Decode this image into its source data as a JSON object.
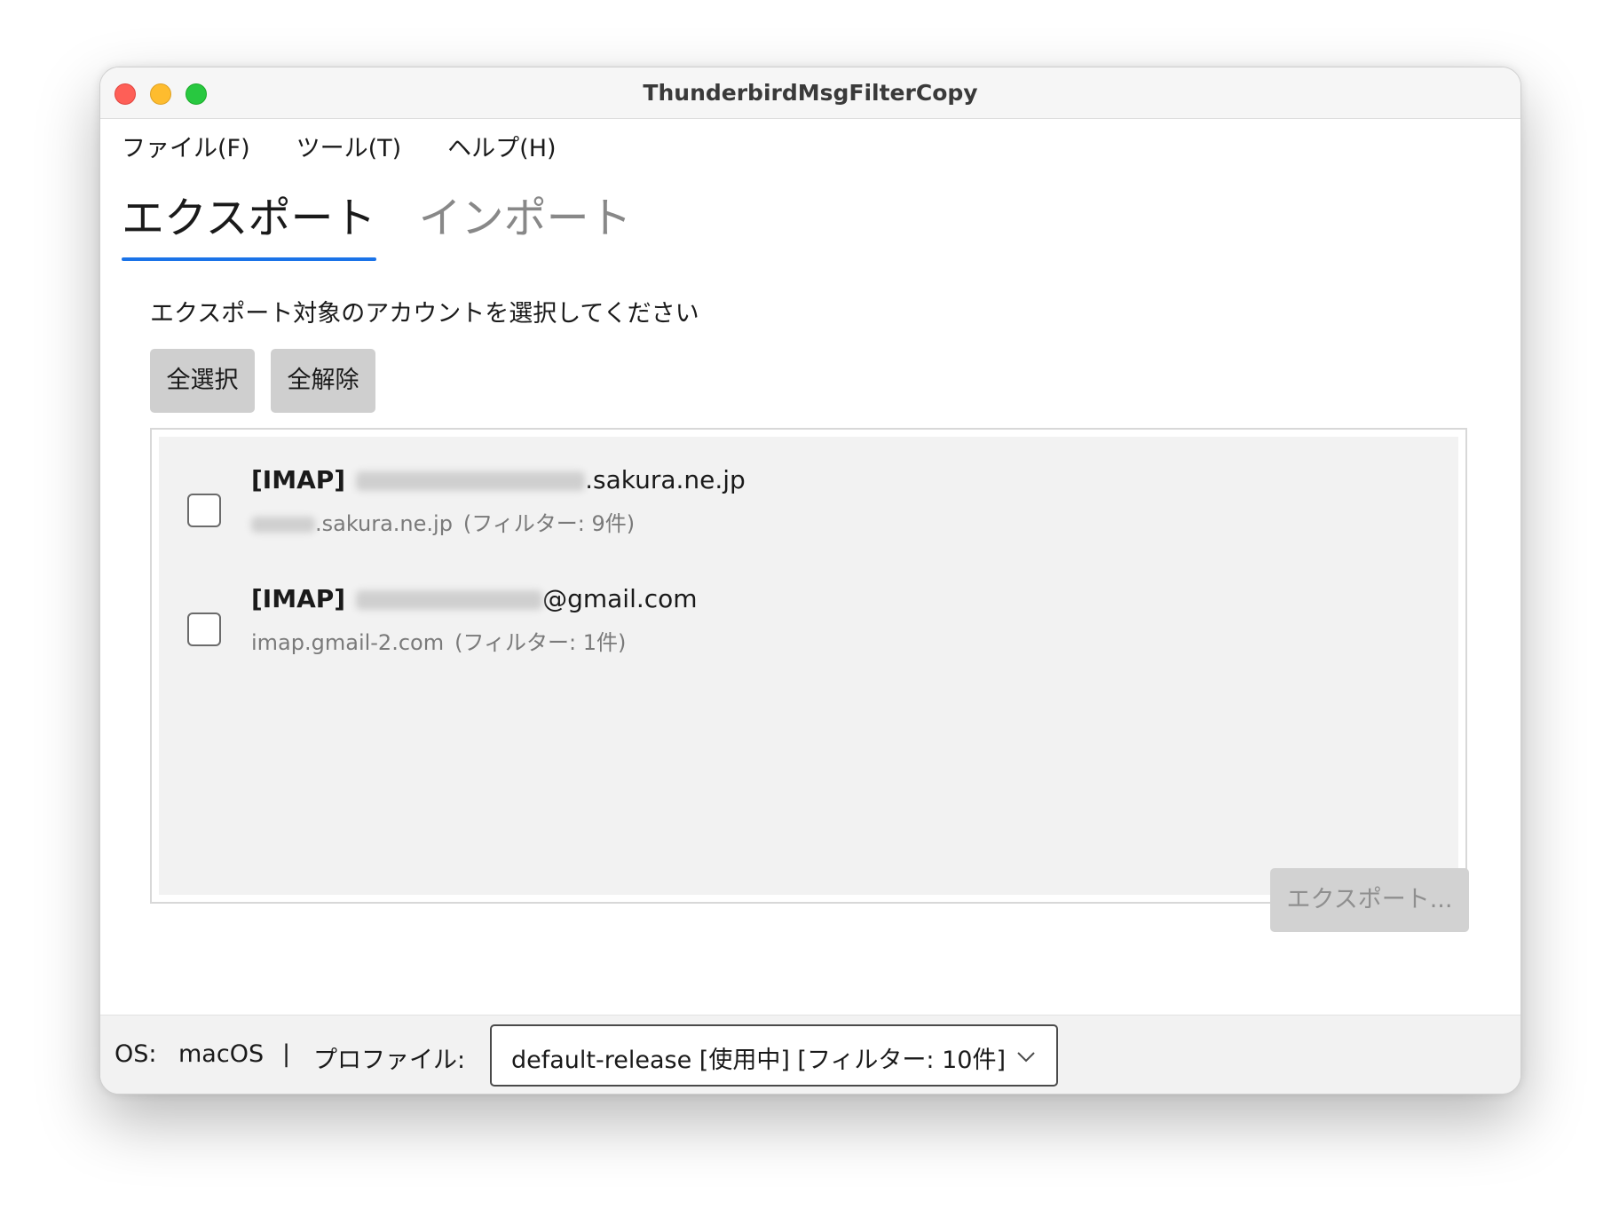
{
  "window": {
    "title": "ThunderbirdMsgFilterCopy"
  },
  "menu": {
    "items": [
      {
        "label": "ファイル(F)"
      },
      {
        "label": "ツール(T)"
      },
      {
        "label": "ヘルプ(H)"
      }
    ]
  },
  "tabs": [
    {
      "label": "エクスポート",
      "active": true
    },
    {
      "label": "インポート",
      "active": false
    }
  ],
  "export": {
    "instruction": "エクスポート対象のアカウントを選択してください",
    "select_all_label": "全選択",
    "deselect_all_label": "全解除",
    "export_button_label": "エクスポート...",
    "accounts": [
      {
        "type": "[IMAP]",
        "email_suffix": ".sakura.ne.jp",
        "server_suffix": ".sakura.ne.jp",
        "filter_count": "(フィルター: 9件)",
        "checked": false
      },
      {
        "type": "[IMAP]",
        "email_suffix": "@gmail.com",
        "server": "imap.gmail-2.com",
        "filter_count": "(フィルター: 1件)",
        "checked": false
      }
    ]
  },
  "status": {
    "os_label": "OS:",
    "os_value": "macOS",
    "separator": "|",
    "profile_label": "プロファイル:",
    "profile_value": "default-release [使用中] [フィルター: 10件]"
  }
}
